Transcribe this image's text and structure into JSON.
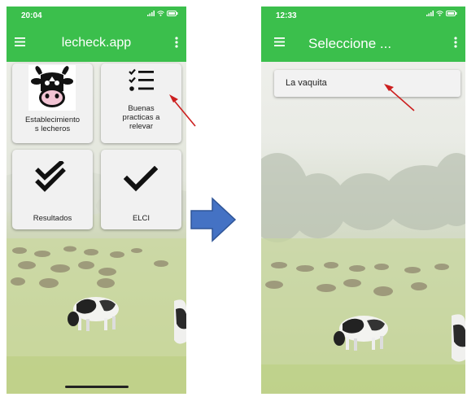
{
  "left_screen": {
    "status_time": "20:04",
    "app_title": "lecheck.app",
    "cards": [
      {
        "label_line1": "Establecimiento",
        "label_line2": "s lecheros",
        "icon": "cow-icon"
      },
      {
        "label_line1": "Buenas",
        "label_line2": "practicas a",
        "label_line3": "relevar",
        "icon": "checklist-icon"
      },
      {
        "label_line1": "Resultados",
        "icon": "double-check-icon"
      },
      {
        "label_line1": "ELCI",
        "icon": "check-icon"
      }
    ]
  },
  "right_screen": {
    "status_time": "12:33",
    "app_title": "Seleccione ...",
    "list_items": [
      "La vaquita"
    ]
  },
  "colors": {
    "appbar": "#3bbf4c",
    "annotation_arrow": "#cc1f1f",
    "transition_arrow": "#4472c4"
  }
}
